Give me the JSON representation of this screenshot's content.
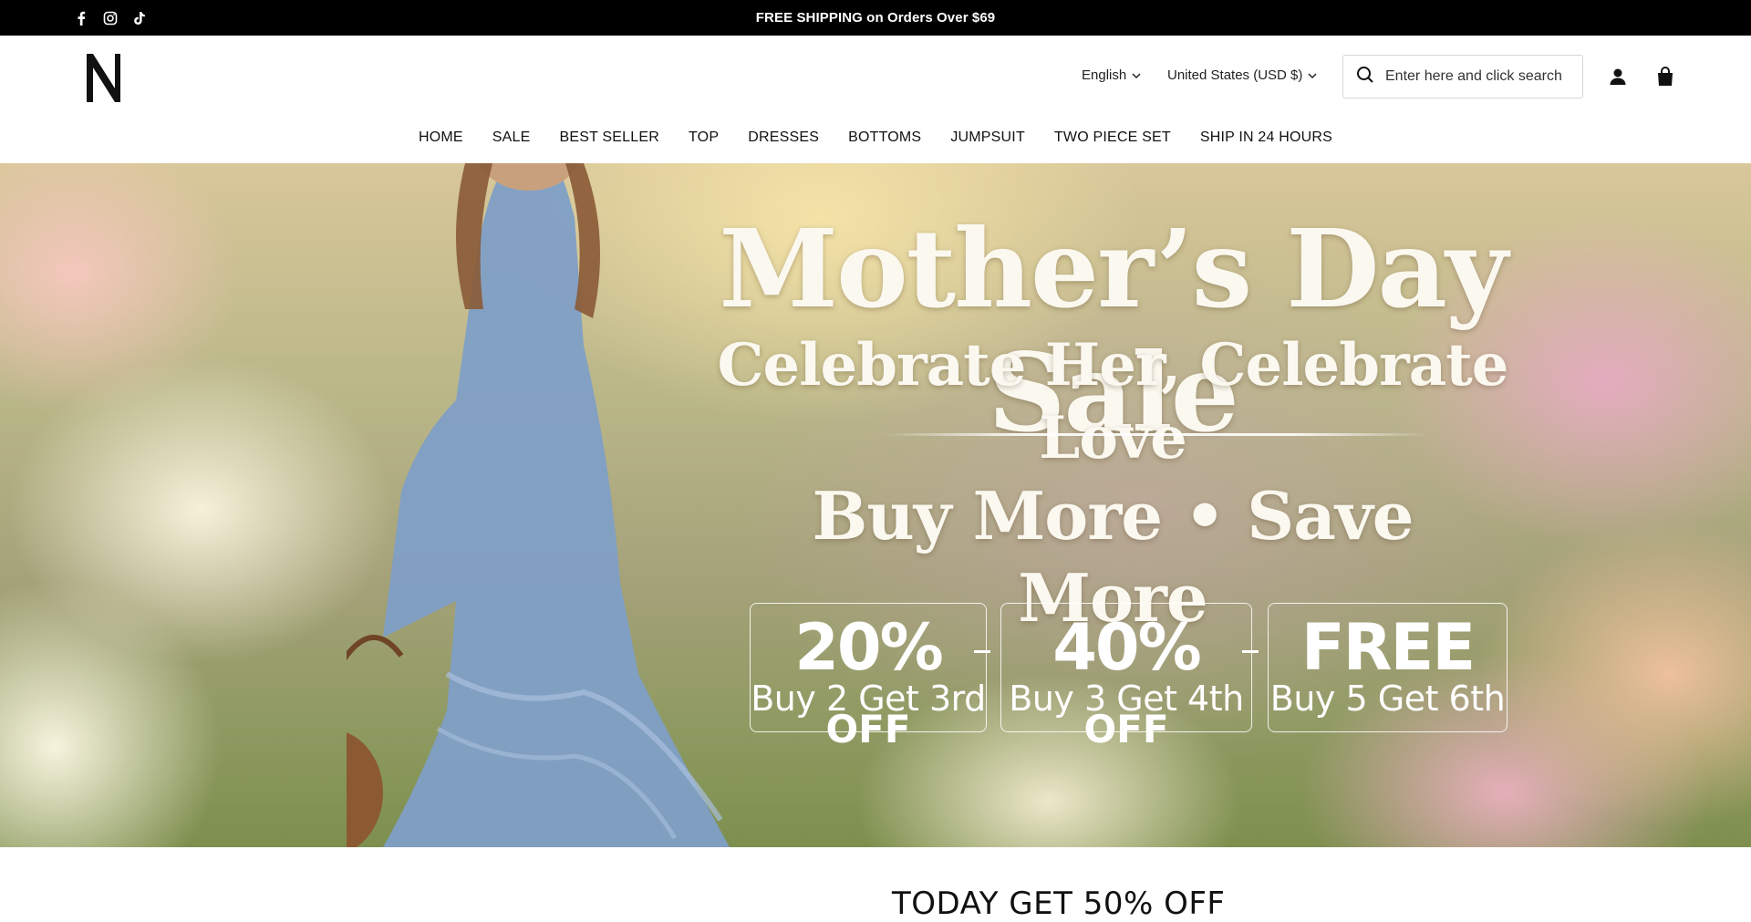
{
  "announcement": {
    "text": "FREE SHIPPING on Orders Over $69"
  },
  "social": [
    "facebook-icon",
    "instagram-icon",
    "tiktok-icon"
  ],
  "header": {
    "language": "English",
    "currency": "United States (USD $)",
    "search_placeholder": "Enter here and click search"
  },
  "nav": [
    "HOME",
    "SALE",
    "BEST SELLER",
    "TOP",
    "DRESSES",
    "BOTTOMS",
    "JUMPSUIT",
    "TWO PIECE SET",
    "SHIP IN 24 HOURS"
  ],
  "hero": {
    "title": "Mother’s Day Sale",
    "subtitle": "Celebrate Her, Celebrate Love",
    "tagline": "Buy More • Save More",
    "offers": [
      {
        "big": "20%",
        "off": "OFF",
        "small": "Buy 2 Get 3rd"
      },
      {
        "big": "40%",
        "off": "OFF",
        "small": "Buy 3 Get 4th"
      },
      {
        "big": "FREE",
        "off": "",
        "small": "Buy 5 Get 6th"
      }
    ]
  },
  "section": {
    "title": "TODAY GET 50% OFF"
  },
  "colors": {
    "topbar": "#000000",
    "text": "#111111",
    "hero_text": "#fbf8f0"
  }
}
